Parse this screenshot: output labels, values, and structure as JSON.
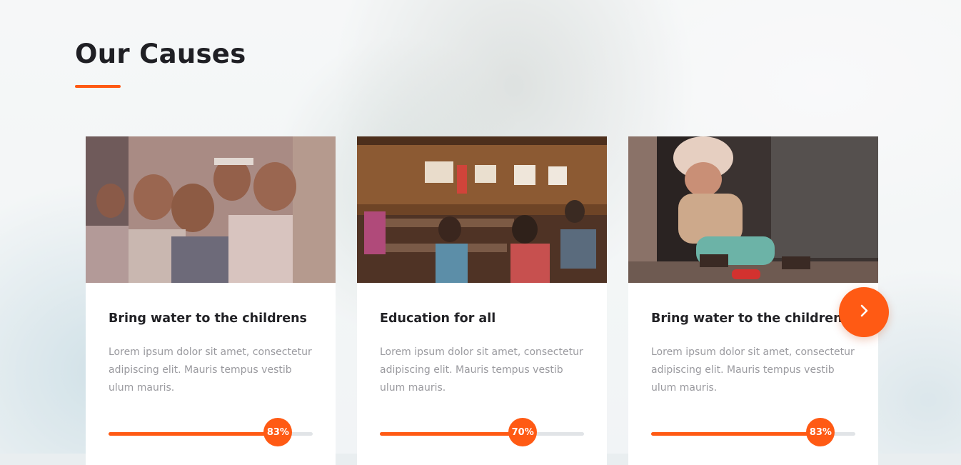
{
  "section": {
    "title": "Our Causes"
  },
  "colors": {
    "accent": "#ff5a14",
    "track": "#e1e4e7"
  },
  "causes": [
    {
      "title": "Bring water to the childrens",
      "description": "Lorem ipsum dolor sit amet, consectetur adipiscing elit. Mauris tempus vestib ulum mauris.",
      "progress_percent": 83,
      "progress_label": "83%",
      "image": "children-group-photo"
    },
    {
      "title": "Education for all",
      "description": "Lorem ipsum dolor sit amet, consectetur adipiscing elit. Mauris tempus vestib ulum mauris.",
      "progress_percent": 70,
      "progress_label": "70%",
      "image": "classroom-photo"
    },
    {
      "title": "Bring water to the childrens",
      "description": "Lorem ipsum dolor sit amet, consectetur adipiscing elit. Mauris tempus vestib ulum mauris.",
      "progress_percent": 83,
      "progress_label": "83%",
      "image": "child-playing-toy-car-photo"
    }
  ],
  "carousel": {
    "next_icon": "chevron-right-icon"
  }
}
